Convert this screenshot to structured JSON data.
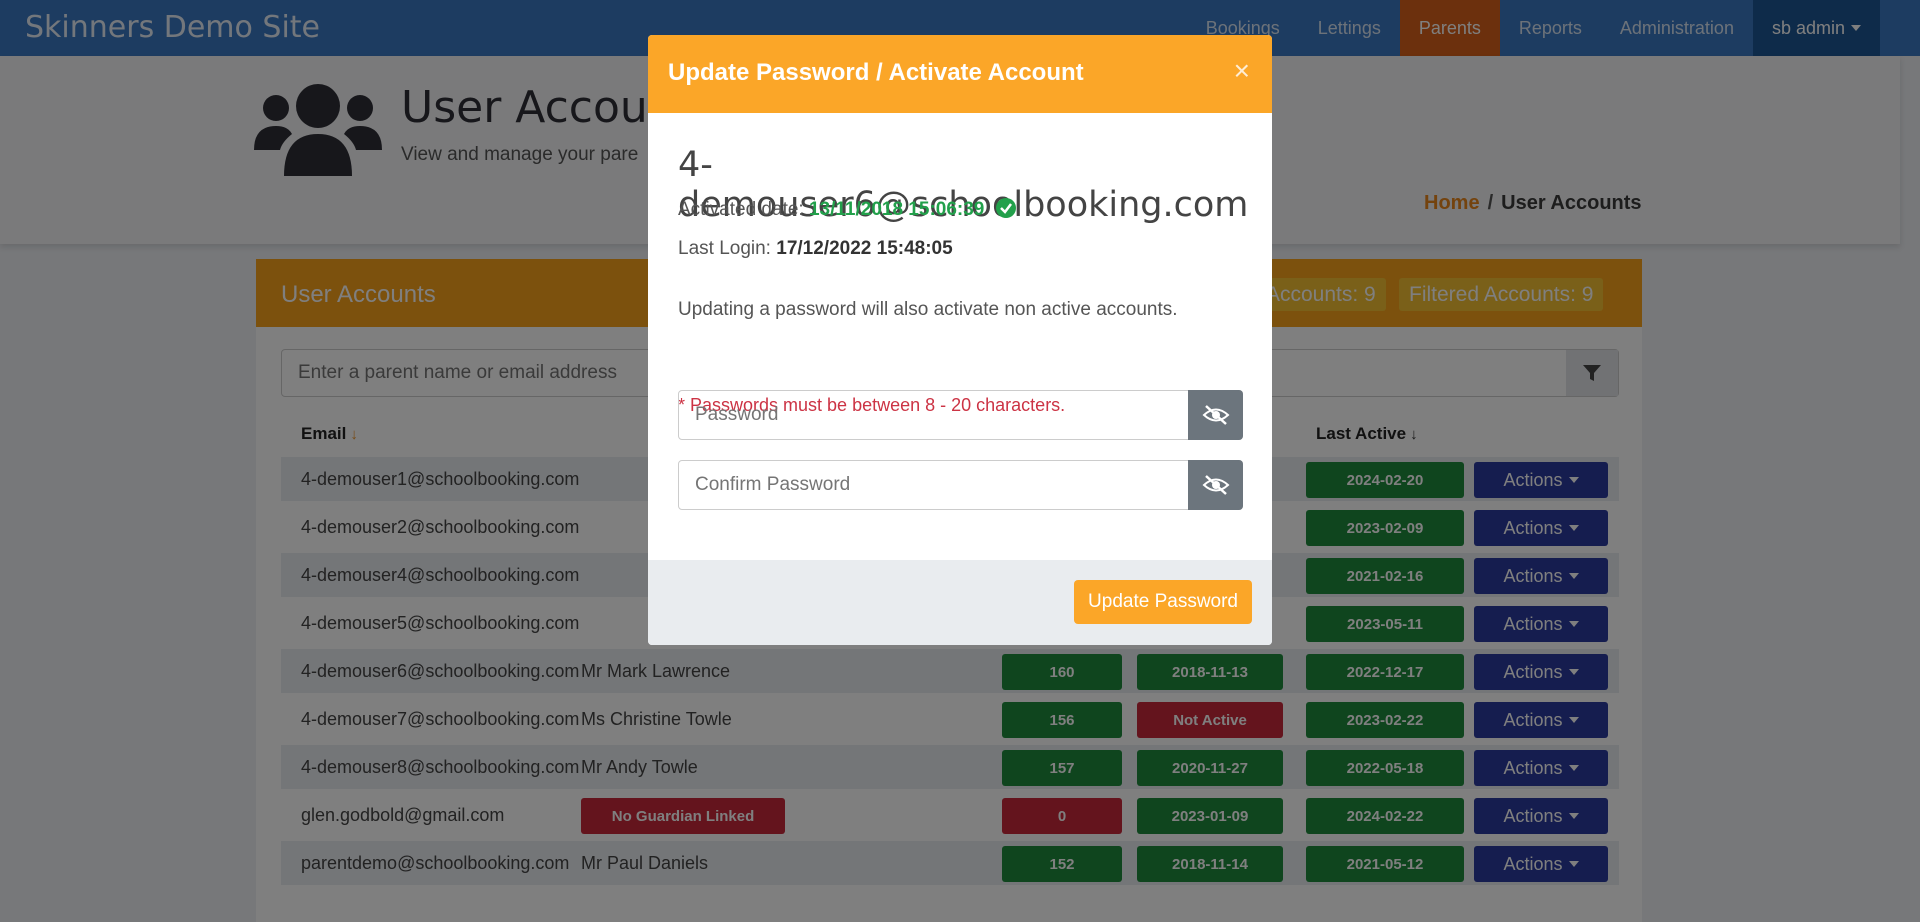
{
  "navbar": {
    "brand": "Skinners Demo Site",
    "items": [
      "Bookings",
      "Lettings",
      "Parents",
      "Reports",
      "Administration"
    ],
    "user": "sb admin"
  },
  "header": {
    "title": "User Accounts",
    "subtitle": "View and manage your pare",
    "breadcrumb_home": "Home",
    "breadcrumb_sep": "/",
    "breadcrumb_current": "User Accounts"
  },
  "card": {
    "title": "User Accounts",
    "total_accounts": "Accounts: 9",
    "filtered_accounts": "Filtered Accounts: 9",
    "search_placeholder": "Enter a parent name or email address",
    "col_email": "Email",
    "col_last_active": "Last Active",
    "rows": [
      {
        "email": "4-demouser1@schoolbooking.com",
        "name": "",
        "count": "",
        "activated": "",
        "last_active": "2024-02-20",
        "actions": "Actions"
      },
      {
        "email": "4-demouser2@schoolbooking.com",
        "name": "",
        "count": "",
        "activated": "",
        "last_active": "2023-02-09",
        "actions": "Actions"
      },
      {
        "email": "4-demouser4@schoolbooking.com",
        "name": "",
        "count": "",
        "activated": "",
        "last_active": "2021-02-16",
        "actions": "Actions"
      },
      {
        "email": "4-demouser5@schoolbooking.com",
        "name": "",
        "count": "",
        "activated": "",
        "last_active": "2023-05-11",
        "actions": "Actions"
      },
      {
        "email": "4-demouser6@schoolbooking.com",
        "name": "Mr Mark Lawrence",
        "count": "160",
        "activated": "2018-11-13",
        "last_active": "2022-12-17",
        "actions": "Actions"
      },
      {
        "email": "4-demouser7@schoolbooking.com",
        "name": "Ms Christine Towle",
        "count": "156",
        "activated": "Not Active",
        "last_active": "2023-02-22",
        "actions": "Actions"
      },
      {
        "email": "4-demouser8@schoolbooking.com",
        "name": "Mr Andy Towle",
        "count": "157",
        "activated": "2020-11-27",
        "last_active": "2022-05-18",
        "actions": "Actions"
      },
      {
        "email": "glen.godbold@gmail.com",
        "name": "No Guardian Linked",
        "count": "0",
        "activated": "2023-01-09",
        "last_active": "2024-02-22",
        "actions": "Actions"
      },
      {
        "email": "parentdemo@schoolbooking.com",
        "name": "Mr Paul Daniels",
        "count": "152",
        "activated": "2018-11-14",
        "last_active": "2021-05-12",
        "actions": "Actions"
      }
    ]
  },
  "modal": {
    "title": "Update Password / Activate Account",
    "close": "×",
    "email": "4-demouser6@schoolbooking.com",
    "activated_label": "Activated date:",
    "activated_value": "13/11/2018 15:06:39",
    "last_login_label": "Last Login:",
    "last_login_value": "17/12/2022 15:48:05",
    "info": "Updating a password will also activate non active accounts.",
    "warning": "* Passwords must be between 8 - 20 characters.",
    "password_placeholder": "Password",
    "confirm_placeholder": "Confirm Password",
    "update_button": "Update Password"
  },
  "colors": {
    "navbar": "#3b79c3",
    "nav_active": "#d9601a",
    "orange": "#f9a21a",
    "green": "#1f8a3c",
    "red": "#c9283a",
    "blue": "#2b3a9e"
  },
  "icons": {
    "users": "users-icon",
    "filter": "filter-icon",
    "eye_slash": "eye-slash-icon",
    "check": "check-circle-icon",
    "sort": "sort-icon"
  }
}
